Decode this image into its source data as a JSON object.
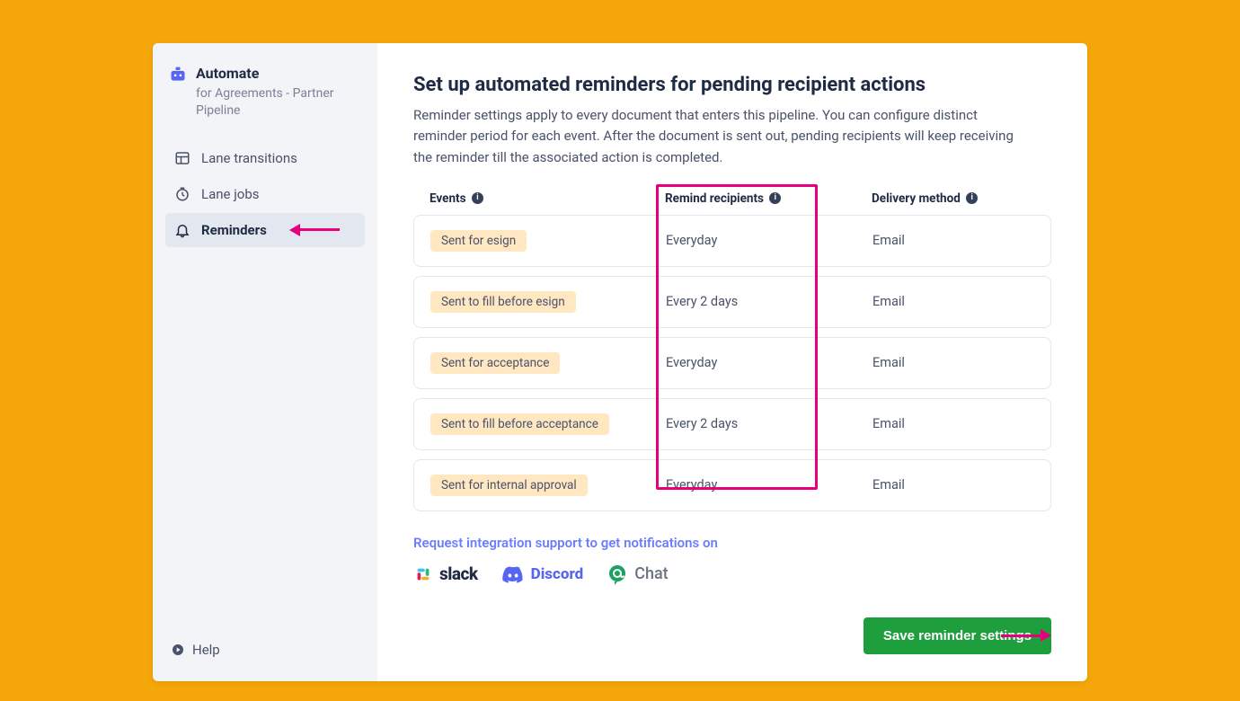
{
  "sidebar": {
    "title": "Automate",
    "subtitle": "for Agreements - Partner Pipeline",
    "nav": [
      {
        "label": "Lane transitions"
      },
      {
        "label": "Lane jobs"
      },
      {
        "label": "Reminders"
      }
    ],
    "help": "Help"
  },
  "main": {
    "title": "Set up automated reminders for pending recipient actions",
    "description": "Reminder settings apply to every document that enters this pipeline. You can configure distinct reminder period for each event. After the document is sent out, pending recipients will keep receiving the reminder till the associated action is completed.",
    "columns": {
      "events": "Events",
      "remind": "Remind recipients",
      "delivery": "Delivery method"
    },
    "rows": [
      {
        "event": "Sent for esign",
        "remind": "Everyday",
        "delivery": "Email"
      },
      {
        "event": "Sent to fill before esign",
        "remind": "Every 2 days",
        "delivery": "Email"
      },
      {
        "event": "Sent for acceptance",
        "remind": "Everyday",
        "delivery": "Email"
      },
      {
        "event": "Sent to fill before acceptance",
        "remind": "Every 2 days",
        "delivery": "Email"
      },
      {
        "event": "Sent for internal approval",
        "remind": "Everyday",
        "delivery": "Email"
      }
    ],
    "integration_title": "Request integration support to get notifications on",
    "integrations": {
      "slack": "slack",
      "discord": "Discord",
      "chat": "Chat"
    },
    "save_label": "Save reminder settings"
  }
}
